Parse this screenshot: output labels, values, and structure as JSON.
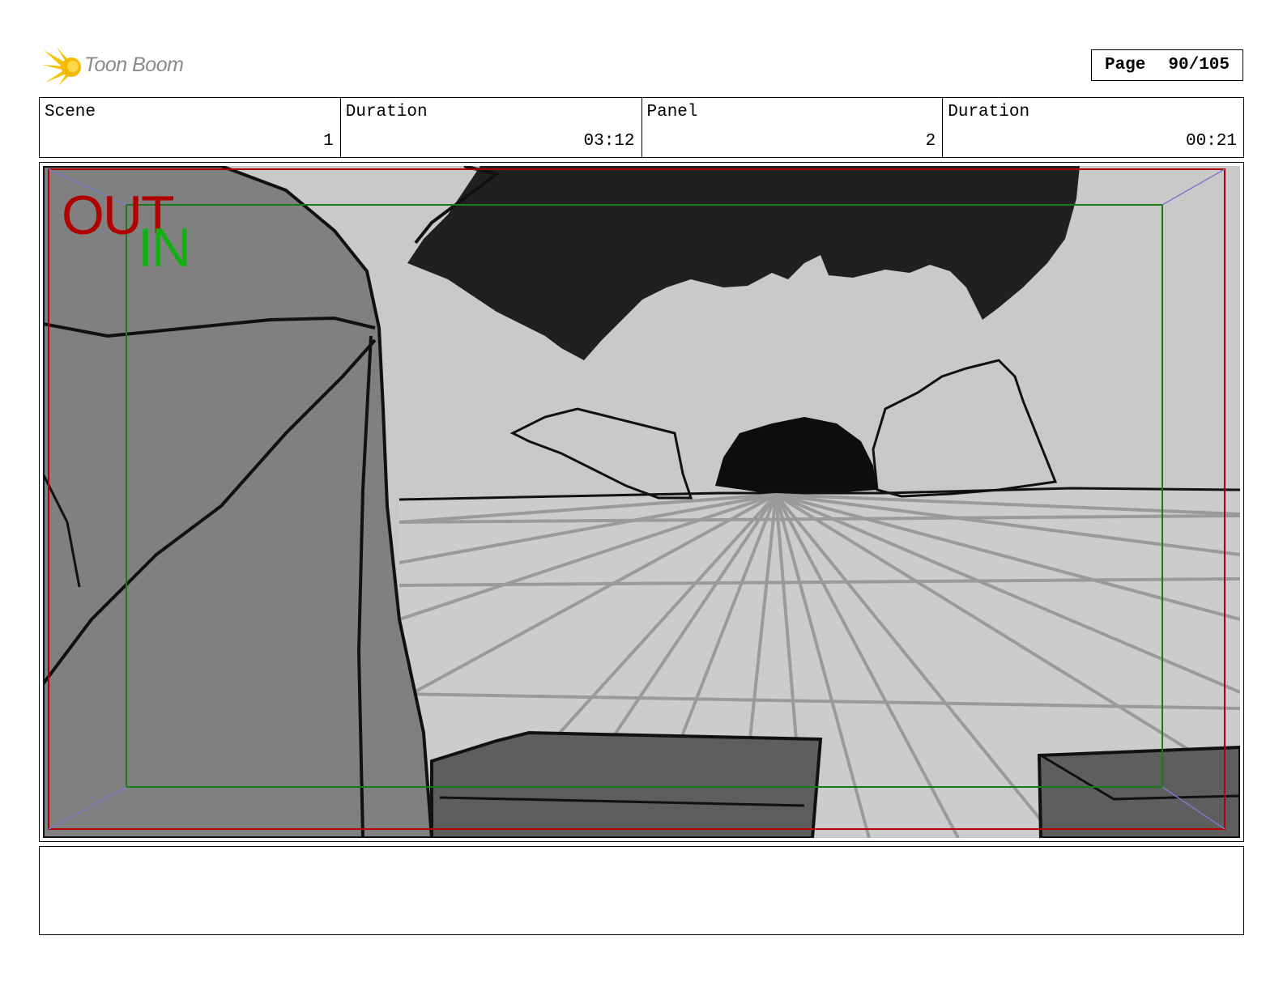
{
  "header": {
    "logo_text": "Toon Boom",
    "page_label": "Page",
    "page_value": "90/105"
  },
  "info": [
    {
      "label": "Scene",
      "value": "1"
    },
    {
      "label": "Duration",
      "value": "03:12"
    },
    {
      "label": "Panel",
      "value": "2"
    },
    {
      "label": "Duration",
      "value": "00:21"
    }
  ],
  "panel": {
    "out_label": "OUT",
    "in_label": "IN",
    "colors": {
      "out_frame": "#b00000",
      "in_frame": "#1a7a1a",
      "corner_guides": "#7a7acc",
      "sky": "#c9c9c9",
      "foliage": "#202020",
      "ground": "#cccccc",
      "foreground_figure": "#808080",
      "table": "#5e5e5e"
    }
  },
  "notes": {
    "text": ""
  },
  "icons": {
    "logo": "toon-boom-burst-icon"
  }
}
